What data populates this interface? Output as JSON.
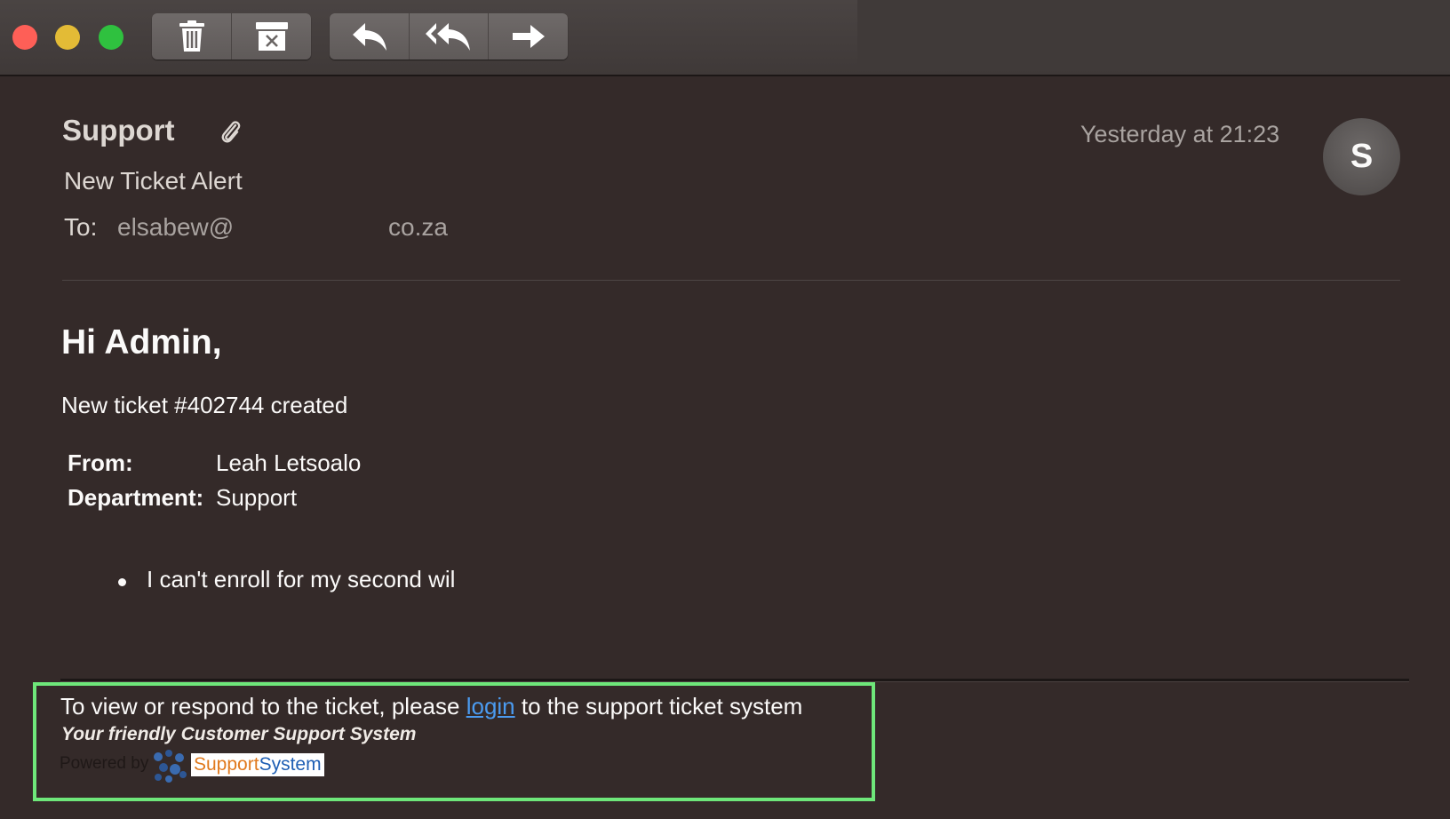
{
  "toolbar": {
    "window_controls": [
      {
        "name": "close",
        "color": "#fe5f57"
      },
      {
        "name": "minimize",
        "color": "#e3bb36"
      },
      {
        "name": "zoom",
        "color": "#2fc13f"
      }
    ],
    "buttons": [
      {
        "name": "trash-icon",
        "action": "delete"
      },
      {
        "name": "archive-icon",
        "action": "junk"
      },
      {
        "name": "reply-icon",
        "action": "reply"
      },
      {
        "name": "reply-all-icon",
        "action": "reply-all"
      },
      {
        "name": "forward-icon",
        "action": "forward"
      }
    ]
  },
  "header": {
    "sender": "Support",
    "has_attachment": true,
    "subject": "New Ticket Alert",
    "to_label": "To:",
    "to_address": "elsabew@",
    "to_domain": "co.za",
    "timestamp": "Yesterday at 21:23",
    "avatar_initial": "S"
  },
  "body": {
    "greeting": "Hi Admin,",
    "ticket_line": "New ticket #402744 created",
    "fields": [
      {
        "label": "From:",
        "value": "Leah Letsoalo"
      },
      {
        "label": "Department:",
        "value": "Support"
      }
    ],
    "bullets": [
      "I can't enroll for my second wil"
    ]
  },
  "footer": {
    "text_before": "To view or respond to the ticket, please ",
    "link_text": "login",
    "text_after": " to the support ticket system",
    "tagline": "Your friendly Customer Support System",
    "powered_by": "Powered by",
    "brand_part1": "Support",
    "brand_part2": "System",
    "highlight_color": "#6ee77a"
  }
}
